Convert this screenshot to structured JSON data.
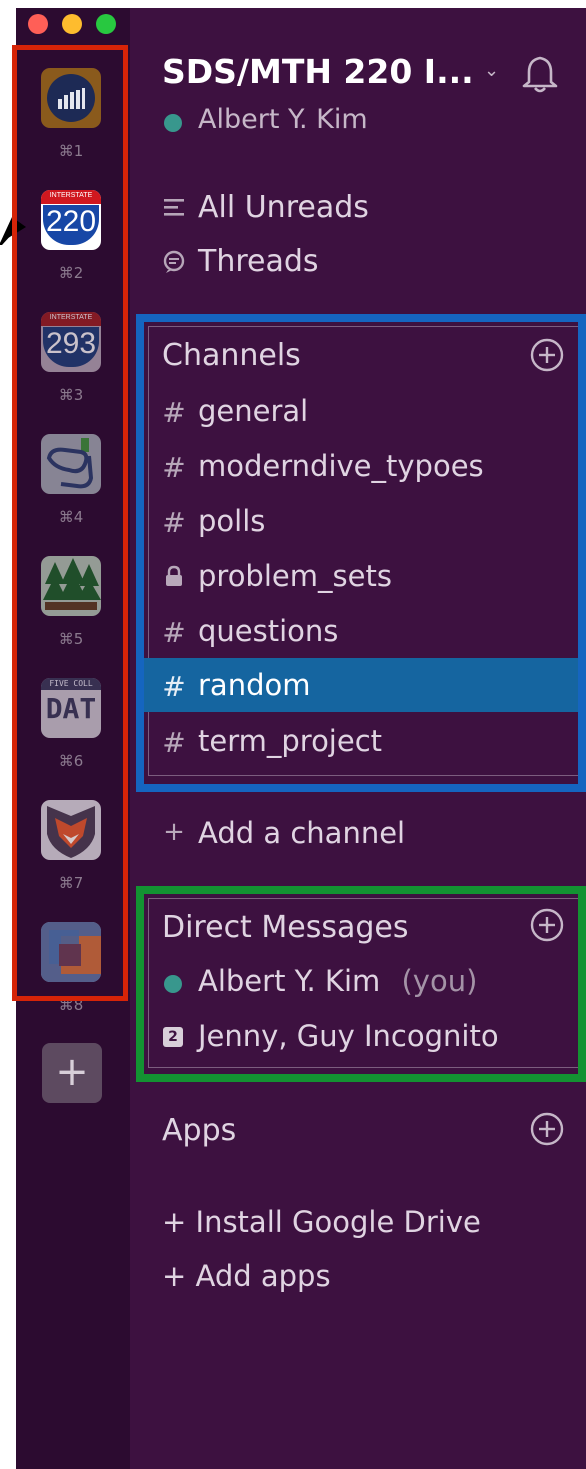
{
  "window_controls": {
    "close_color": "#ff5f57",
    "minimize_color": "#febc2e",
    "zoom_color": "#28c840"
  },
  "workspaces": [
    {
      "shortcut": "⌘1",
      "icon": "bar-chart-logo"
    },
    {
      "shortcut": "⌘2",
      "icon": "interstate-220-shield",
      "badge_top": "INTERSTATE",
      "badge_number": "220"
    },
    {
      "shortcut": "⌘3",
      "icon": "interstate-293-shield",
      "badge_top": "INTERSTATE",
      "badge_number": "293"
    },
    {
      "shortcut": "⌘4",
      "icon": "scuba-mask-logo"
    },
    {
      "shortcut": "⌘5",
      "icon": "pine-trees-logo"
    },
    {
      "shortcut": "⌘6",
      "icon": "five-college-data-logo",
      "badge_top": "FIVE COLL",
      "badge_text": "DAT"
    },
    {
      "shortcut": "⌘7",
      "icon": "fox-shield-logo"
    },
    {
      "shortcut": "⌘8",
      "icon": "color-squares-logo"
    }
  ],
  "team": {
    "name": "SDS/MTH 220 I...",
    "user": "Albert Y. Kim",
    "presence_color": "#38978d"
  },
  "nav": {
    "all_unreads": "All Unreads",
    "threads": "Threads"
  },
  "channels": {
    "header": "Channels",
    "items": [
      {
        "name": "general",
        "icon": "hash"
      },
      {
        "name": "moderndive_typoes",
        "icon": "hash"
      },
      {
        "name": "polls",
        "icon": "hash"
      },
      {
        "name": "problem_sets",
        "icon": "lock"
      },
      {
        "name": "questions",
        "icon": "hash"
      },
      {
        "name": "random",
        "icon": "hash",
        "selected": true
      },
      {
        "name": "term_project",
        "icon": "hash"
      }
    ],
    "add_label": "Add a channel"
  },
  "direct_messages": {
    "header": "Direct Messages",
    "items": [
      {
        "name": "Albert Y. Kim",
        "suffix": "(you)",
        "icon": "presence-dot"
      },
      {
        "name": "Jenny, Guy Incognito",
        "badge": "2"
      }
    ]
  },
  "apps": {
    "header": "Apps",
    "install_google_drive": "+ Install Google Drive",
    "add_apps": "+ Add apps"
  },
  "colors": {
    "sidebar_bg": "#3d1140",
    "rail_bg": "#2c0b30",
    "selected_bg": "#1565a0",
    "annotation_red": "#d62408",
    "annotation_blue": "#1565c0",
    "annotation_green": "#139232"
  }
}
